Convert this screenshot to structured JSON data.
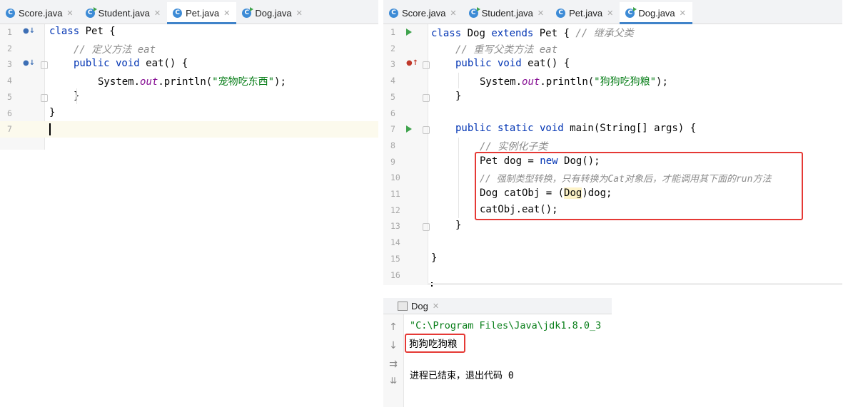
{
  "left_editor": {
    "tabs": [
      {
        "label": "Score.java",
        "icon": "class-icon"
      },
      {
        "label": "Student.java",
        "icon": "runnable-class-icon"
      },
      {
        "label": "Pet.java",
        "icon": "class-icon",
        "active": true
      },
      {
        "label": "Dog.java",
        "icon": "runnable-class-icon"
      }
    ],
    "line_numbers": [
      "1",
      "2",
      "3",
      "4",
      "5",
      "6",
      "7"
    ],
    "code": {
      "l1_kw": "class",
      "l1_rest": " Pet {",
      "l2_comment": "// 定义方法 eat",
      "l3_kw": "public void",
      "l3_rest": " eat() {",
      "l4_a": "System.",
      "l4_field": "out",
      "l4_b": ".println(",
      "l4_str": "\"宠物吃东西\"",
      "l4_c": ");",
      "l5": "}",
      "l6": "}"
    }
  },
  "right_editor": {
    "tabs": [
      {
        "label": "Score.java",
        "icon": "class-icon"
      },
      {
        "label": "Student.java",
        "icon": "runnable-class-icon"
      },
      {
        "label": "Pet.java",
        "icon": "class-icon"
      },
      {
        "label": "Dog.java",
        "icon": "runnable-class-icon",
        "active": true
      }
    ],
    "line_numbers": [
      "1",
      "2",
      "3",
      "4",
      "5",
      "6",
      "7",
      "8",
      "9",
      "10",
      "11",
      "12",
      "13",
      "14",
      "15",
      "16"
    ],
    "code": {
      "l1_kw1": "class",
      "l1_mid": " Dog ",
      "l1_kw2": "extends",
      "l1_rest": " Pet { ",
      "l1_comment": "// 继承父类",
      "l2_comment": "// 重写父类方法 eat",
      "l3_kw": "public void",
      "l3_rest": " eat() {",
      "l4_a": "System.",
      "l4_field": "out",
      "l4_b": ".println(",
      "l4_str": "\"狗狗吃狗粮\"",
      "l4_c": ");",
      "l5": "}",
      "l7_kw": "public static void",
      "l7_rest": " main(String[] args) {",
      "l8_comment": "// 实例化子类",
      "l9_a": "Pet dog = ",
      "l9_kw": "new",
      "l9_b": " Dog();",
      "l10_comment": "// 强制类型转换，只有转换为Cat对象后，才能调用其下面的run方法",
      "l11_a": "Dog catObj = (",
      "l11_hl": "Dog",
      "l11_b": ")dog;",
      "l12": "catObj.eat();",
      "l13": "}",
      "l15": "}"
    }
  },
  "run_panel": {
    "tab_label": "Dog",
    "command_line": "\"C:\\Program Files\\Java\\jdk1.8.0_3",
    "output_line": "狗狗吃狗粮",
    "exit_line": "进程已结束，退出代码 0"
  },
  "colors": {
    "keyword": "#0033b3",
    "comment": "#8c8c8c",
    "string": "#067d17",
    "annotation_box": "#e53935"
  }
}
